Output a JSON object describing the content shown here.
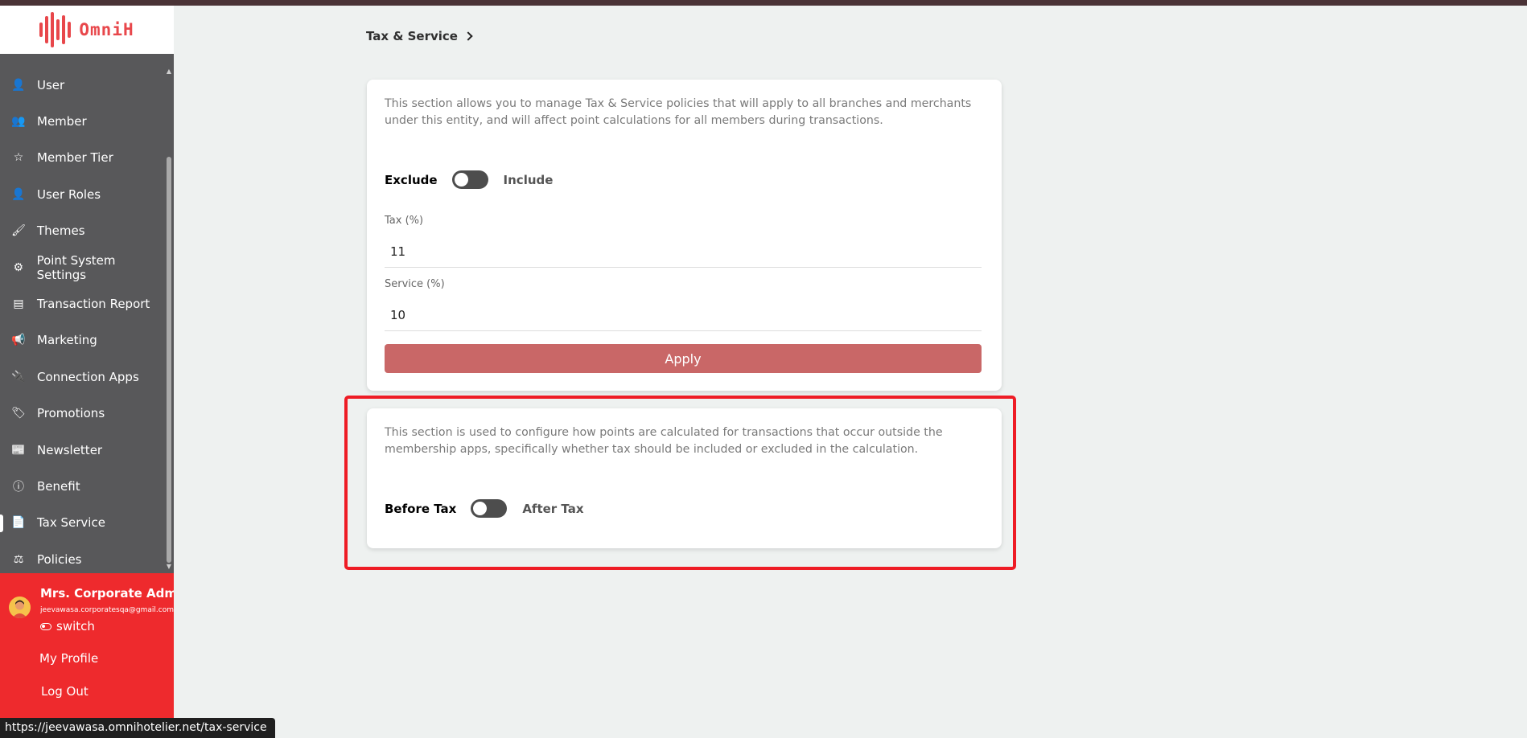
{
  "brand": {
    "name": "OmniH",
    "color": "#e8474b"
  },
  "sidebar": {
    "items": [
      {
        "label": "User",
        "icon": "user-plus-icon",
        "glyph": "👤",
        "active": false
      },
      {
        "label": "Member",
        "icon": "users-icon",
        "glyph": "👥",
        "active": false
      },
      {
        "label": "Member Tier",
        "icon": "star-icon",
        "glyph": "☆",
        "active": false
      },
      {
        "label": "User Roles",
        "icon": "user-gear-icon",
        "glyph": "👤",
        "active": false
      },
      {
        "label": "Themes",
        "icon": "brush-icon",
        "glyph": "🖌",
        "active": false
      },
      {
        "label": "Point System Settings",
        "icon": "gear-icon",
        "glyph": "⚙",
        "active": false
      },
      {
        "label": "Transaction Report",
        "icon": "report-icon",
        "glyph": "▤",
        "active": false
      },
      {
        "label": "Marketing",
        "icon": "megaphone-icon",
        "glyph": "📢",
        "active": false
      },
      {
        "label": "Connection Apps",
        "icon": "plug-icon",
        "glyph": "🔌",
        "active": false
      },
      {
        "label": "Promotions",
        "icon": "tags-icon",
        "glyph": "🏷",
        "active": false
      },
      {
        "label": "Newsletter",
        "icon": "newspaper-icon",
        "glyph": "📰",
        "active": false
      },
      {
        "label": "Benefit",
        "icon": "info-icon",
        "glyph": "ⓘ",
        "active": false
      },
      {
        "label": "Tax Service",
        "icon": "document-icon",
        "glyph": "📄",
        "active": true
      },
      {
        "label": "Policies",
        "icon": "scale-icon",
        "glyph": "⚖",
        "active": false
      }
    ]
  },
  "user": {
    "name": "Mrs. Corporate Admin",
    "email": "jeevawasa.corporatesqa@gmail.com",
    "switch_label": "switch",
    "my_profile": "My Profile",
    "log_out": "Log Out"
  },
  "breadcrumb": {
    "title": "Tax & Service"
  },
  "tax_card": {
    "description": "This section allows you to manage Tax & Service policies that will apply to all branches and merchants under this entity, and will affect point calculations for all members during transactions.",
    "toggle_left": "Exclude",
    "toggle_right": "Include",
    "toggle_on": false,
    "tax_label": "Tax (%)",
    "tax_value": "11",
    "service_label": "Service (%)",
    "service_value": "10",
    "apply_label": "Apply"
  },
  "points_card": {
    "description": "This section is used to configure how points are calculated for transactions that occur outside the membership apps, specifically whether tax should be included or excluded in the calculation.",
    "toggle_left": "Before Tax",
    "toggle_right": "After Tax",
    "toggle_on": false
  },
  "status_bar": {
    "url": "https://jeevawasa.omnihotelier.net/tax-service"
  },
  "colors": {
    "sidebar": "#58585a",
    "user_panel": "#ee2a2d",
    "apply": "#c96767",
    "highlight": "#ee1c25"
  }
}
